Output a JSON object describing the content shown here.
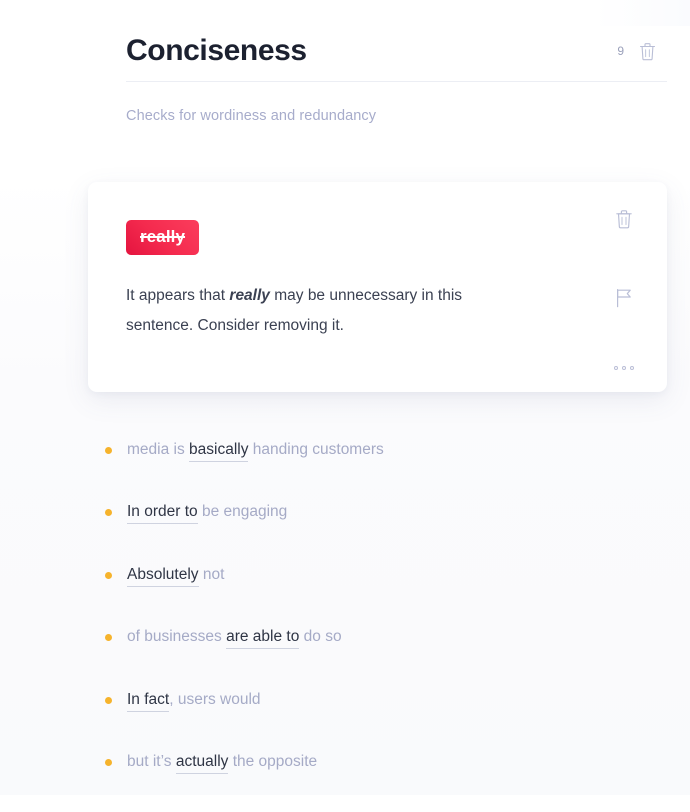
{
  "header": {
    "title": "Conciseness",
    "count": "9",
    "delete_icon": "trash-icon",
    "subtitle": "Checks for wordiness and redundancy"
  },
  "card": {
    "chip_label": "really",
    "chip_strikethrough": true,
    "message_prefix": "It appears that ",
    "message_emphasis": "really",
    "message_suffix": " may be unnecessary in this sentence. Consider removing it.",
    "actions": [
      {
        "name": "delete-suggestion",
        "icon": "trash-icon"
      },
      {
        "name": "flag-suggestion",
        "icon": "flag-icon"
      },
      {
        "name": "more-options",
        "icon": "ellipsis-icon"
      }
    ]
  },
  "suggestions": [
    {
      "before": "media is ",
      "hit": "basically",
      "after": " handing customers"
    },
    {
      "before": "",
      "hit": "In order to",
      "after": " be engaging"
    },
    {
      "before": "",
      "hit": "Absolutely",
      "after": " not"
    },
    {
      "before": "of businesses ",
      "hit": "are able to",
      "after": " do so"
    },
    {
      "before": "",
      "hit": "In fact",
      "after": ", users would"
    },
    {
      "before": "but it’s ",
      "hit": "actually",
      "after": " the opposite"
    }
  ],
  "colors": {
    "accent_red_dark": "#e4143f",
    "accent_red_light": "#fb3d5c",
    "bullet_amber": "#f6b32c",
    "text_dark": "#1c2130",
    "text_muted": "#a5aac6",
    "card_background": "#ffffff"
  }
}
